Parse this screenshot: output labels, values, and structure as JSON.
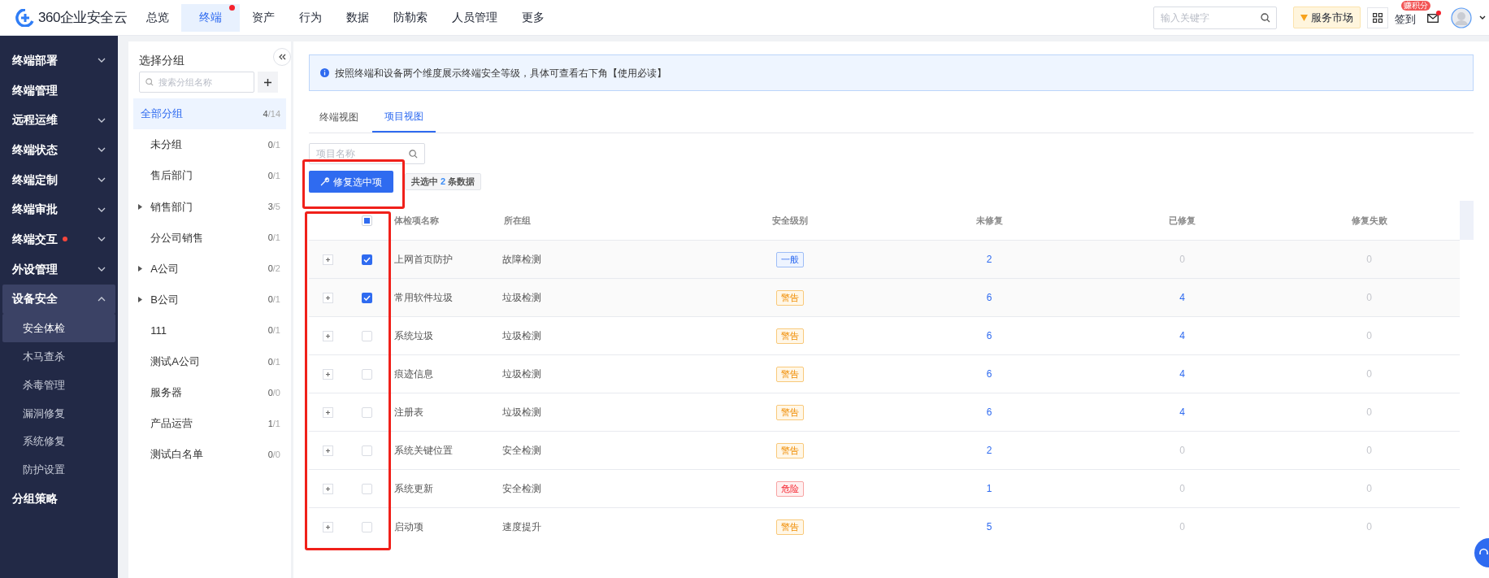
{
  "header": {
    "logo": "360企业安全云",
    "nav": [
      {
        "label": "总览",
        "selected": false,
        "notice": false
      },
      {
        "label": "终端",
        "selected": true,
        "notice": true
      },
      {
        "label": "资产",
        "selected": false,
        "notice": false
      },
      {
        "label": "行为",
        "selected": false,
        "notice": false
      },
      {
        "label": "数据",
        "selected": false,
        "notice": false
      },
      {
        "label": "防勒索",
        "selected": false,
        "notice": false
      },
      {
        "label": "人员管理",
        "selected": false,
        "notice": false
      },
      {
        "label": "更多",
        "selected": false,
        "notice": false
      }
    ],
    "search": {
      "placeholder": "输入关键字"
    },
    "market": "服务市场",
    "checkin": "签到",
    "checkin_badge": "赚积分",
    "mail_notice": true
  },
  "sidebar": {
    "items": [
      {
        "label": "终端部署",
        "expandable": true,
        "expanded": false,
        "notice": false,
        "selected": false
      },
      {
        "label": "终端管理",
        "expandable": false,
        "notice": false,
        "selected": false
      },
      {
        "label": "远程运维",
        "expandable": true,
        "expanded": false,
        "notice": false,
        "selected": false
      },
      {
        "label": "终端状态",
        "expandable": true,
        "expanded": false,
        "notice": false,
        "selected": false
      },
      {
        "label": "终端定制",
        "expandable": true,
        "expanded": false,
        "notice": false,
        "selected": false
      },
      {
        "label": "终端审批",
        "expandable": true,
        "expanded": false,
        "notice": false,
        "selected": false
      },
      {
        "label": "终端交互",
        "expandable": true,
        "expanded": false,
        "notice": true,
        "selected": false
      },
      {
        "label": "外设管理",
        "expandable": true,
        "expanded": false,
        "notice": false,
        "selected": false
      },
      {
        "label": "设备安全",
        "expandable": true,
        "expanded": true,
        "notice": false,
        "selected": true,
        "children": [
          {
            "label": "安全体检",
            "selected": true
          },
          {
            "label": "木马查杀",
            "selected": false
          },
          {
            "label": "杀毒管理",
            "selected": false
          },
          {
            "label": "漏洞修复",
            "selected": false
          },
          {
            "label": "系统修复",
            "selected": false
          },
          {
            "label": "防护设置",
            "selected": false
          }
        ]
      },
      {
        "label": "分组策略",
        "expandable": false,
        "notice": false,
        "selected": false
      }
    ]
  },
  "groups": {
    "title": "选择分组",
    "search": {
      "placeholder": "搜索分组名称"
    },
    "items": [
      {
        "label": "全部分组",
        "count": "4",
        "total": "/14",
        "selected": true,
        "expandable": false
      },
      {
        "label": "未分组",
        "count": "0",
        "total": "/1",
        "selected": false,
        "expandable": false
      },
      {
        "label": "售后部门",
        "count": "0",
        "total": "/1",
        "selected": false,
        "expandable": false
      },
      {
        "label": "销售部门",
        "count": "3",
        "total": "/5",
        "selected": false,
        "expandable": true
      },
      {
        "label": "分公司销售",
        "count": "0",
        "total": "/1",
        "selected": false,
        "expandable": false
      },
      {
        "label": "A公司",
        "count": "0",
        "total": "/2",
        "selected": false,
        "expandable": true
      },
      {
        "label": "B公司",
        "count": "0",
        "total": "/1",
        "selected": false,
        "expandable": true
      },
      {
        "label": "111",
        "count": "0",
        "total": "/1",
        "selected": false,
        "expandable": false
      },
      {
        "label": "测试A公司",
        "count": "0",
        "total": "/1",
        "selected": false,
        "expandable": false
      },
      {
        "label": "服务器",
        "count": "0",
        "total": "/0",
        "selected": false,
        "expandable": false
      },
      {
        "label": "产品运营",
        "count": "1",
        "total": "/1",
        "selected": false,
        "expandable": false
      },
      {
        "label": "测试白名单",
        "count": "0",
        "total": "/0",
        "selected": false,
        "expandable": false
      }
    ]
  },
  "notice": "按照终端和设备两个维度展示终端安全等级，具体可查看右下角【使用必读】",
  "tabs": [
    {
      "label": "终端视图",
      "selected": false
    },
    {
      "label": "项目视图",
      "selected": true
    }
  ],
  "item_search": {
    "placeholder": "项目名称"
  },
  "repair_button": "修复选中项",
  "selection": {
    "before": "共选中",
    "count": "2",
    "after": "条数据"
  },
  "table": {
    "select_all": {
      "checked": false,
      "indeterminate": true
    },
    "columns": [
      "体检项名称",
      "所在组",
      "安全级别",
      "未修复",
      "已修复",
      "修复失败"
    ],
    "rows": [
      {
        "name": "上网首页防护",
        "group": "故障检测",
        "level": {
          "text": "一般",
          "kind": "normal"
        },
        "unfixed": {
          "text": "2",
          "link": true
        },
        "fixed": {
          "text": "0",
          "link": false
        },
        "failed": {
          "text": "0",
          "link": false
        },
        "checked": true
      },
      {
        "name": "常用软件垃圾",
        "group": "垃圾检测",
        "level": {
          "text": "警告",
          "kind": "warning"
        },
        "unfixed": {
          "text": "6",
          "link": true
        },
        "fixed": {
          "text": "4",
          "link": true
        },
        "failed": {
          "text": "0",
          "link": false
        },
        "checked": true
      },
      {
        "name": "系统垃圾",
        "group": "垃圾检测",
        "level": {
          "text": "警告",
          "kind": "warning"
        },
        "unfixed": {
          "text": "6",
          "link": true
        },
        "fixed": {
          "text": "4",
          "link": true
        },
        "failed": {
          "text": "0",
          "link": false
        },
        "checked": false
      },
      {
        "name": "痕迹信息",
        "group": "垃圾检测",
        "level": {
          "text": "警告",
          "kind": "warning"
        },
        "unfixed": {
          "text": "6",
          "link": true
        },
        "fixed": {
          "text": "4",
          "link": true
        },
        "failed": {
          "text": "0",
          "link": false
        },
        "checked": false
      },
      {
        "name": "注册表",
        "group": "垃圾检测",
        "level": {
          "text": "警告",
          "kind": "warning"
        },
        "unfixed": {
          "text": "6",
          "link": true
        },
        "fixed": {
          "text": "4",
          "link": true
        },
        "failed": {
          "text": "0",
          "link": false
        },
        "checked": false
      },
      {
        "name": "系统关键位置",
        "group": "安全检测",
        "level": {
          "text": "警告",
          "kind": "warning"
        },
        "unfixed": {
          "text": "2",
          "link": true
        },
        "fixed": {
          "text": "0",
          "link": false
        },
        "failed": {
          "text": "0",
          "link": false
        },
        "checked": false
      },
      {
        "name": "系统更新",
        "group": "安全检测",
        "level": {
          "text": "危险",
          "kind": "danger"
        },
        "unfixed": {
          "text": "1",
          "link": true
        },
        "fixed": {
          "text": "0",
          "link": false
        },
        "failed": {
          "text": "0",
          "link": false
        },
        "checked": false
      },
      {
        "name": "启动项",
        "group": "速度提升",
        "level": {
          "text": "警告",
          "kind": "warning"
        },
        "unfixed": {
          "text": "5",
          "link": true
        },
        "fixed": {
          "text": "0",
          "link": false
        },
        "failed": {
          "text": "0",
          "link": false
        },
        "checked": false
      }
    ]
  }
}
